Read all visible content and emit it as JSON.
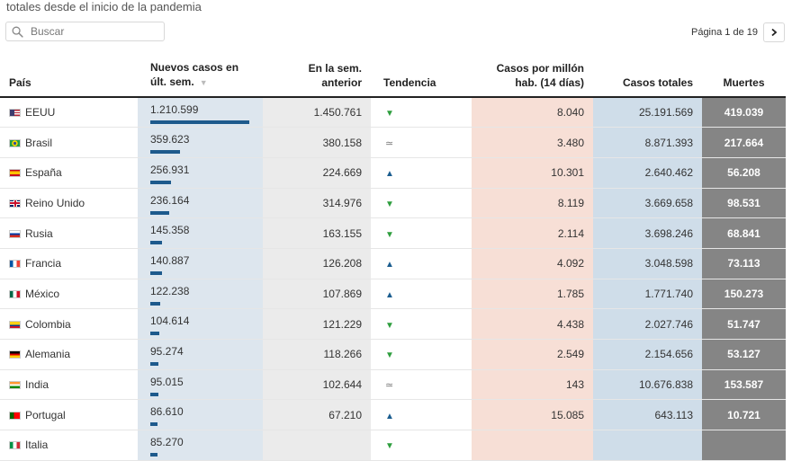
{
  "subtitle": "totales desde el inicio de la pandemia",
  "search": {
    "placeholder": "Buscar"
  },
  "pagination": {
    "label": "Página 1 de 19"
  },
  "columns": {
    "country": "País",
    "new_cases_l1": "Nuevos casos en",
    "new_cases_l2": "últ. sem.",
    "prev_week_l1": "En la sem.",
    "prev_week_l2": "anterior",
    "trend": "Tendencia",
    "per_million_l1": "Casos por millón",
    "per_million_l2": "hab. (14 días)",
    "total": "Casos totales",
    "deaths": "Muertes"
  },
  "rows": [
    {
      "country": "EEUU",
      "flag": "us-flag",
      "new_cases": "1.210.599",
      "new_cases_value": 1210599,
      "prev_week": "1.450.761",
      "trend": "down",
      "per_million": "8.040",
      "total": "25.191.569",
      "deaths": "419.039"
    },
    {
      "country": "Brasil",
      "flag": "brazil-flag",
      "new_cases": "359.623",
      "new_cases_value": 359623,
      "prev_week": "380.158",
      "trend": "equal",
      "per_million": "3.480",
      "total": "8.871.393",
      "deaths": "217.664"
    },
    {
      "country": "España",
      "flag": "spain-flag",
      "new_cases": "256.931",
      "new_cases_value": 256931,
      "prev_week": "224.669",
      "trend": "up",
      "per_million": "10.301",
      "total": "2.640.462",
      "deaths": "56.208"
    },
    {
      "country": "Reino Unido",
      "flag": "uk-flag",
      "new_cases": "236.164",
      "new_cases_value": 236164,
      "prev_week": "314.976",
      "trend": "down",
      "per_million": "8.119",
      "total": "3.669.658",
      "deaths": "98.531"
    },
    {
      "country": "Rusia",
      "flag": "russia-flag",
      "new_cases": "145.358",
      "new_cases_value": 145358,
      "prev_week": "163.155",
      "trend": "down",
      "per_million": "2.114",
      "total": "3.698.246",
      "deaths": "68.841"
    },
    {
      "country": "Francia",
      "flag": "france-flag",
      "new_cases": "140.887",
      "new_cases_value": 140887,
      "prev_week": "126.208",
      "trend": "up",
      "per_million": "4.092",
      "total": "3.048.598",
      "deaths": "73.113"
    },
    {
      "country": "México",
      "flag": "mexico-flag",
      "new_cases": "122.238",
      "new_cases_value": 122238,
      "prev_week": "107.869",
      "trend": "up",
      "per_million": "1.785",
      "total": "1.771.740",
      "deaths": "150.273"
    },
    {
      "country": "Colombia",
      "flag": "colombia-flag",
      "new_cases": "104.614",
      "new_cases_value": 104614,
      "prev_week": "121.229",
      "trend": "down",
      "per_million": "4.438",
      "total": "2.027.746",
      "deaths": "51.747"
    },
    {
      "country": "Alemania",
      "flag": "germany-flag",
      "new_cases": "95.274",
      "new_cases_value": 95274,
      "prev_week": "118.266",
      "trend": "down",
      "per_million": "2.549",
      "total": "2.154.656",
      "deaths": "53.127"
    },
    {
      "country": "India",
      "flag": "india-flag",
      "new_cases": "95.015",
      "new_cases_value": 95015,
      "prev_week": "102.644",
      "trend": "equal",
      "per_million": "143",
      "total": "10.676.838",
      "deaths": "153.587"
    },
    {
      "country": "Portugal",
      "flag": "portugal-flag",
      "new_cases": "86.610",
      "new_cases_value": 86610,
      "prev_week": "67.210",
      "trend": "up",
      "per_million": "15.085",
      "total": "643.113",
      "deaths": "10.721"
    },
    {
      "country": "Italia",
      "flag": "italy-flag",
      "new_cases": "85.270",
      "new_cases_value": 85270,
      "prev_week": "",
      "trend": "down",
      "per_million": "",
      "total": "",
      "deaths": ""
    }
  ],
  "trend_symbols": {
    "down": "▼",
    "up": "▲",
    "equal": "≃"
  },
  "colors": {
    "bar": "#1e5a8c",
    "new_cases_bg": "#dde6ee",
    "prev_week_bg": "#ebebeb",
    "per_million_bg": "#f7dfd6",
    "total_bg": "#cfdde9",
    "deaths_bg": "#858585",
    "trend_down": "#2e9e3e",
    "trend_up": "#1b5d8f"
  }
}
